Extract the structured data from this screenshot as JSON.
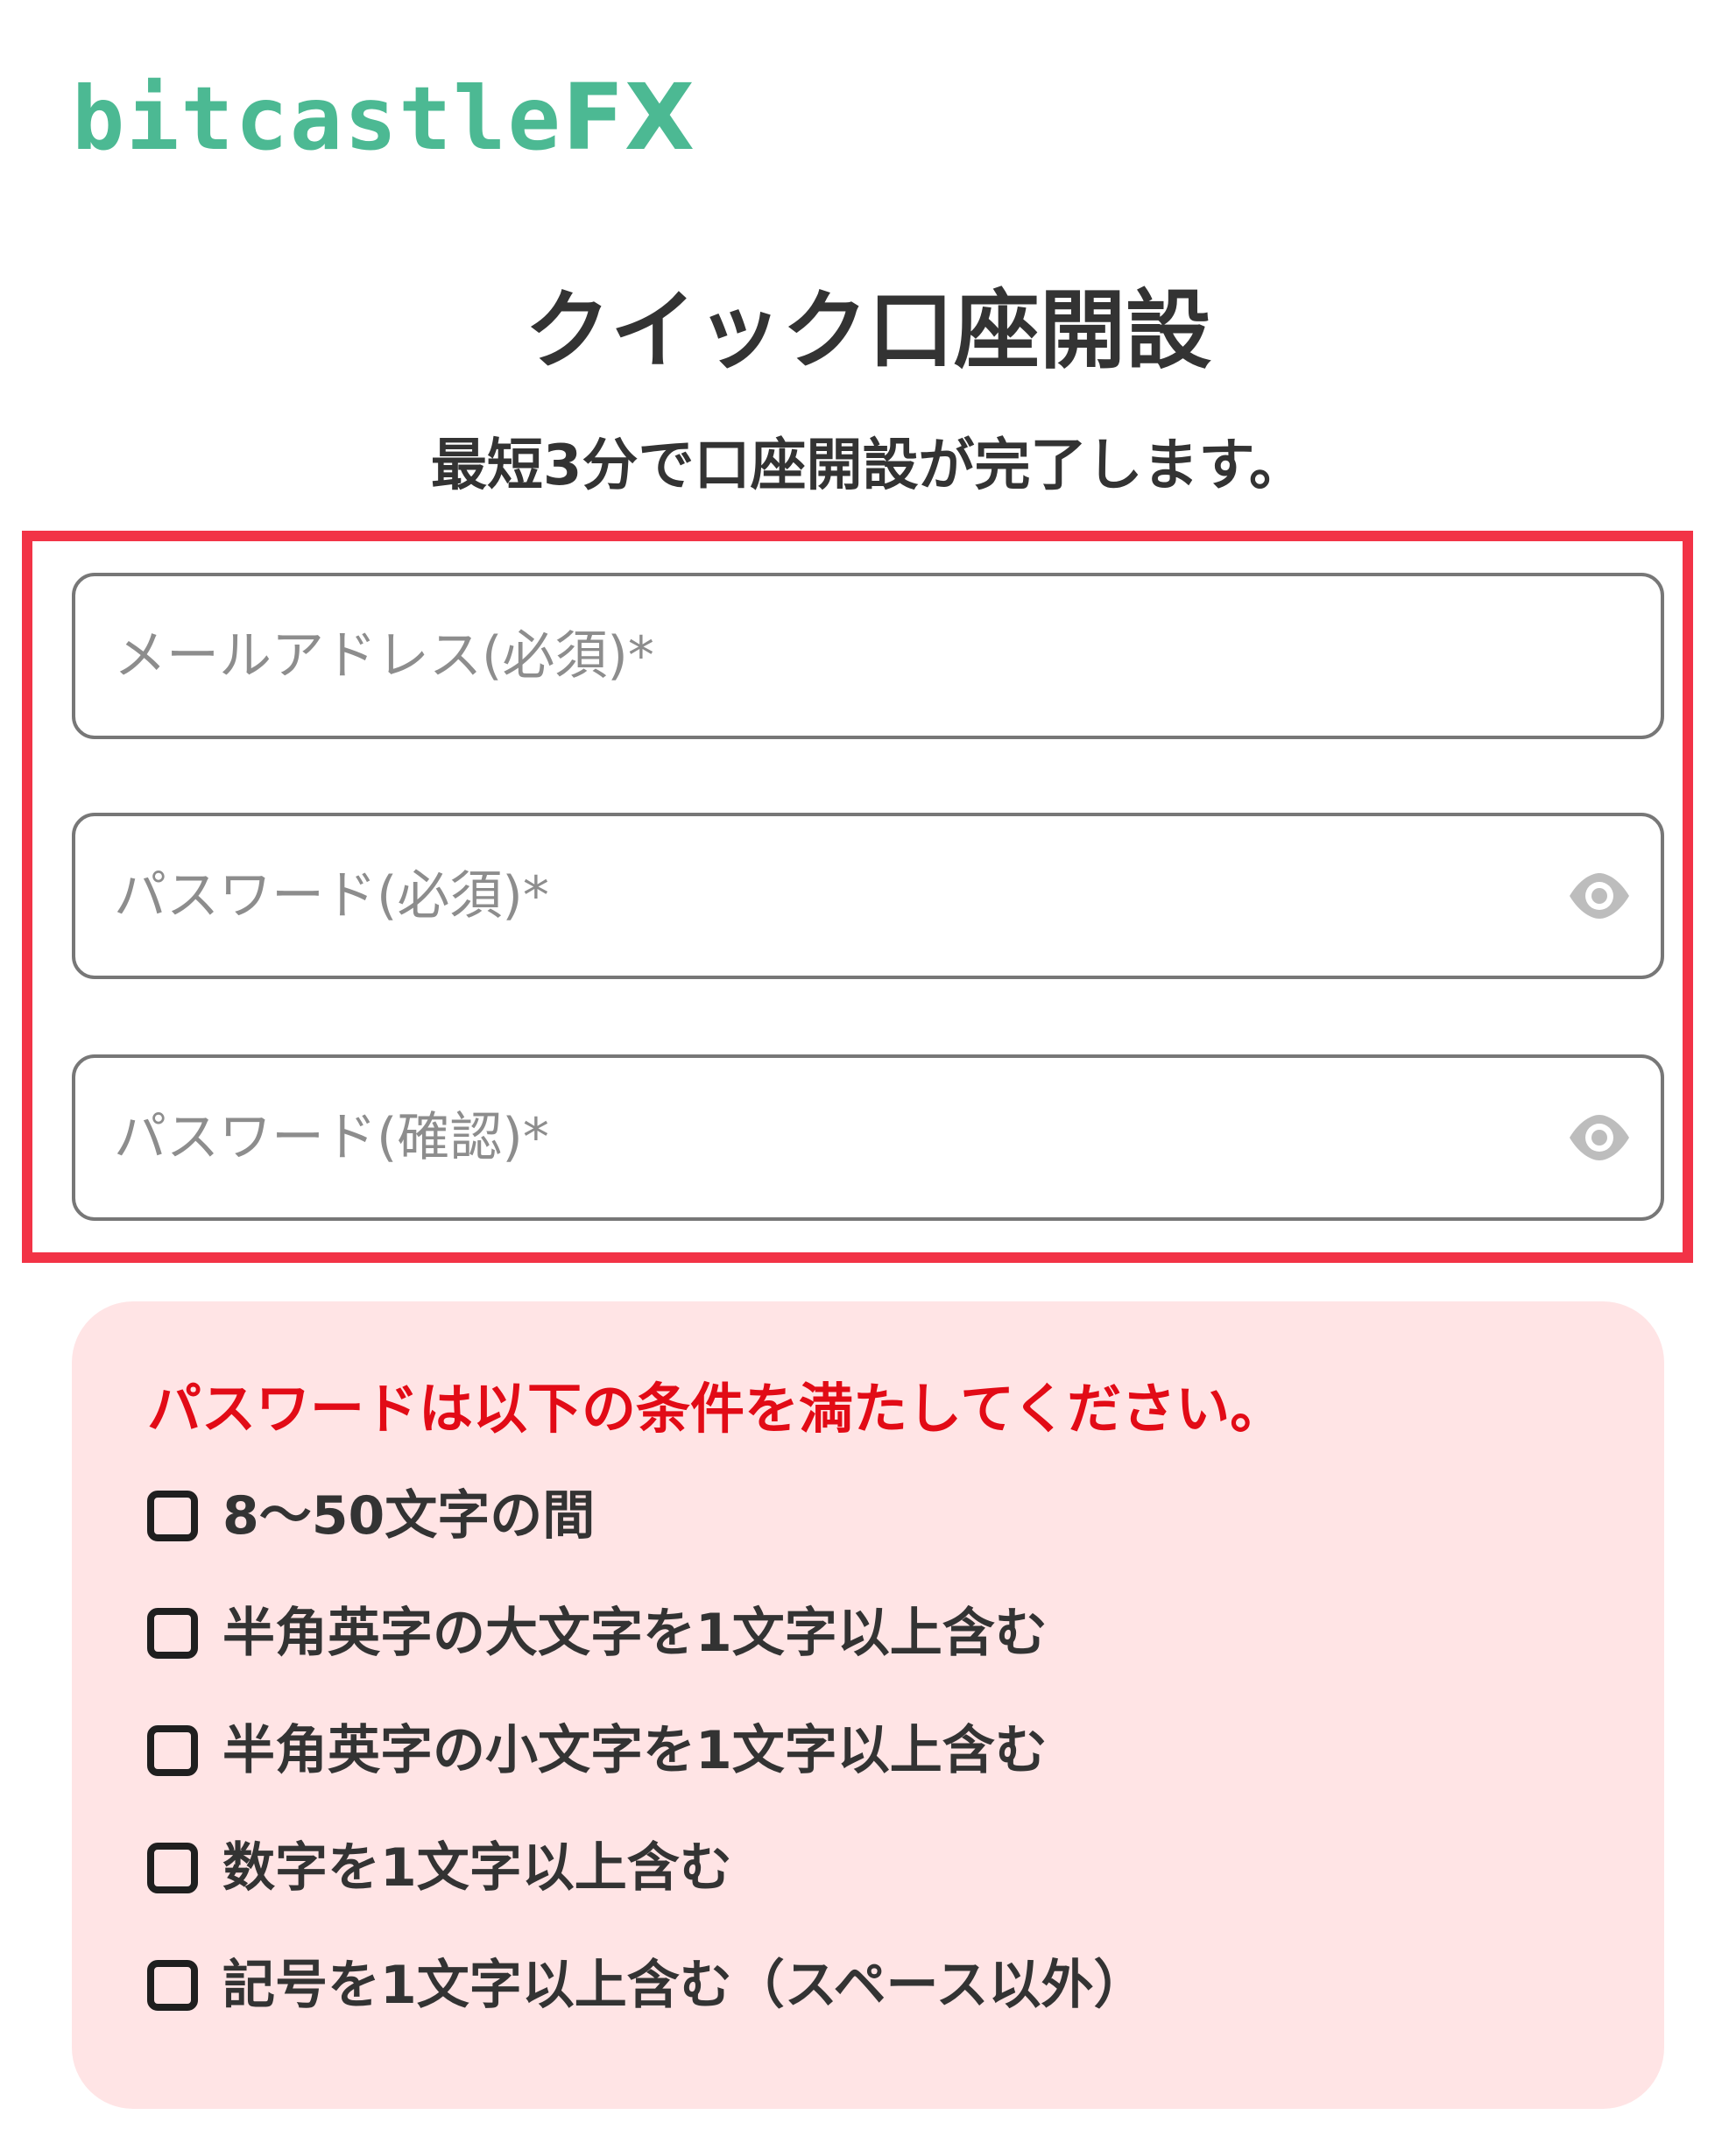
{
  "brand": {
    "logo_main": "bitcastle",
    "logo_suffix": "FX"
  },
  "header": {
    "title": "クイック口座開設",
    "subtitle": "最短3分で口座開設が完了します。"
  },
  "form": {
    "email_placeholder": "メールアドレス(必須)*",
    "email_value": "",
    "password_placeholder": "パスワード(必須)*",
    "password_value": "",
    "password_confirm_placeholder": "パスワード(確認)*",
    "password_confirm_value": "",
    "visibility_icon": "eye-icon"
  },
  "conditions": {
    "heading": "パスワードは以下の条件を満たしてください。",
    "items": [
      {
        "label": "8〜50文字の間",
        "checked": false
      },
      {
        "label": "半角英字の大文字を1文字以上含む",
        "checked": false
      },
      {
        "label": "半角英字の小文字を1文字以上含む",
        "checked": false
      },
      {
        "label": "数字を1文字以上含む",
        "checked": false
      },
      {
        "label": "記号を1文字以上含む（スペース以外）",
        "checked": false
      }
    ]
  },
  "colors": {
    "brand": "#4cb993",
    "highlight": "#f23346",
    "warning_text": "#e20b16",
    "conditions_bg": "#ffe4e5"
  }
}
